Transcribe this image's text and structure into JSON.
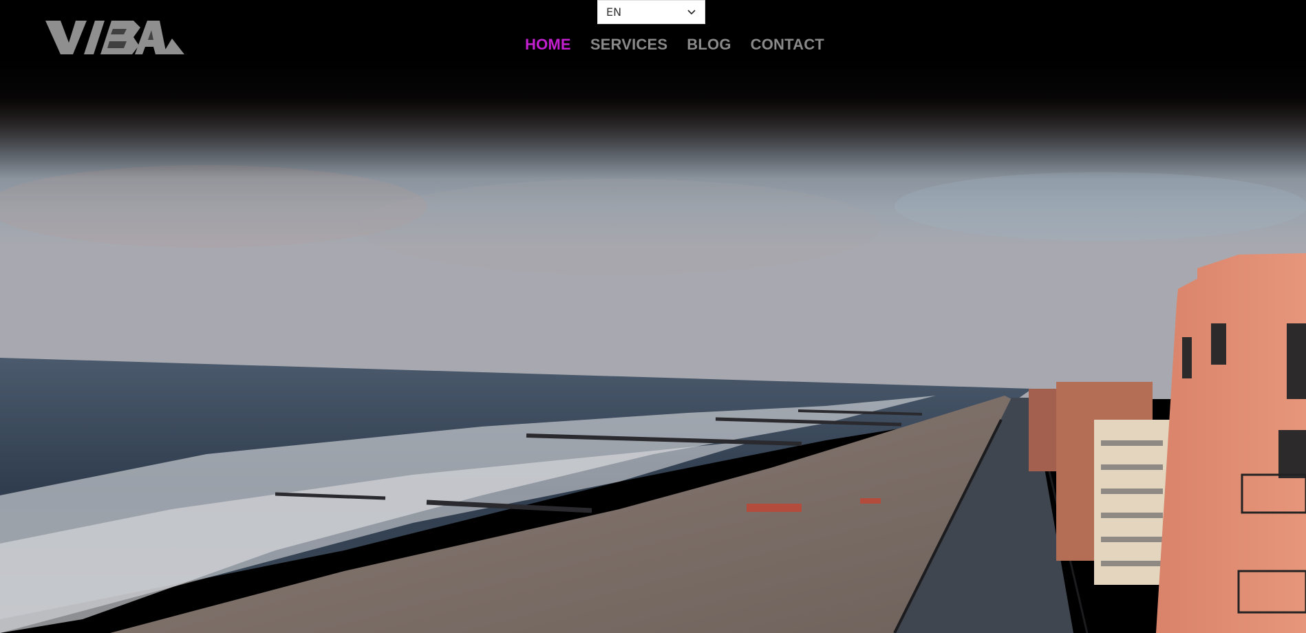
{
  "header": {
    "logo_text": "VIBAL",
    "language": {
      "selected": "EN"
    },
    "nav": {
      "items": [
        {
          "label": "HOME",
          "active": true
        },
        {
          "label": "SERVICES",
          "active": false
        },
        {
          "label": "BLOG",
          "active": false
        },
        {
          "label": "CONTACT",
          "active": false
        }
      ]
    }
  },
  "hero": {
    "scene": "aerial-beach-boardwalk-video"
  },
  "colors": {
    "nav_active": "#c41fd1",
    "nav_inactive": "#8a8a8a",
    "background": "#000000"
  },
  "icons": {
    "language_dropdown": "chevron-down-icon"
  }
}
